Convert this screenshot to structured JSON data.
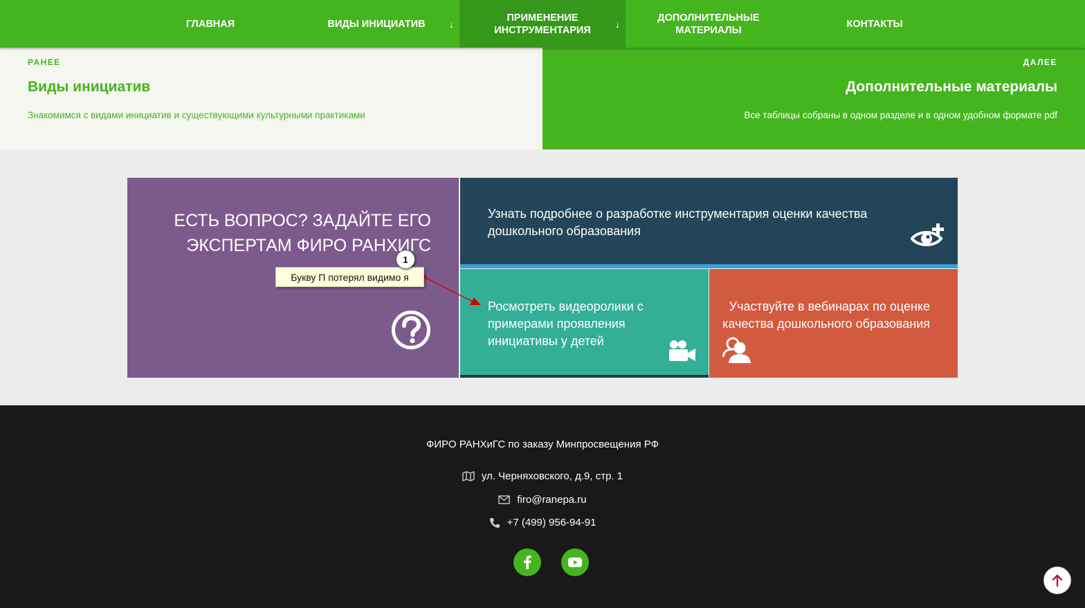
{
  "nav": {
    "items": [
      {
        "label": "ГЛАВНАЯ"
      },
      {
        "label": "ВИДЫ ИНИЦИАТИВ",
        "arrow": "↓"
      },
      {
        "label": "ПРИМЕНЕНИЕ ИНСТРУМЕНТАРИЯ",
        "arrow": "↓"
      },
      {
        "label": "ДОПОЛНИТЕЛЬНЫЕ МАТЕРИАЛЫ"
      },
      {
        "label": "КОНТАКТЫ"
      }
    ]
  },
  "prev": {
    "kicker": "РАНЕЕ",
    "title": "Виды инициатив",
    "description": "Знакомимся с видами инициатив и существующими культурными практиками"
  },
  "next": {
    "kicker": "ДАЛЕЕ",
    "title": "Дополнительные материалы",
    "description": "Все таблицы собраны в одном разделе и в одном удобном формате pdf"
  },
  "tiles": {
    "ask": {
      "title": "ЕСТЬ ВОПРОС? ЗАДАЙТЕ ЕГО ЭКСПЕРТАМ ФИРО РАНХИГС",
      "icon": "question-circle-icon"
    },
    "learn": {
      "title": "Узнать подробнее о разработке инструментария оценки качества дошкольного образования",
      "icon": "eye-plus-icon"
    },
    "video": {
      "title": "Росмотреть видеоролики с примерами проявления инициативы у детей",
      "icon": "video-camera-icon"
    },
    "webinar": {
      "title": "Участвуйте в вебинарах по оценке качества дошкольного образования",
      "icon": "users-icon"
    }
  },
  "annotation": {
    "number": "1",
    "text": "Букву П потерял видимо я"
  },
  "footer": {
    "org": "ФИРО РАНХиГС по заказу Минпросвещения РФ",
    "address": "ул. Черняховского, д.9, стр. 1",
    "email": "firo@ranepa.ru",
    "phone": "+7 (499) 956-94-91"
  },
  "colors": {
    "accent": "#44b51e",
    "purple": "#7d5a8c",
    "navy": "#234459",
    "teal": "#33af98",
    "coral": "#d25a3e",
    "footer_bg": "#191919"
  }
}
